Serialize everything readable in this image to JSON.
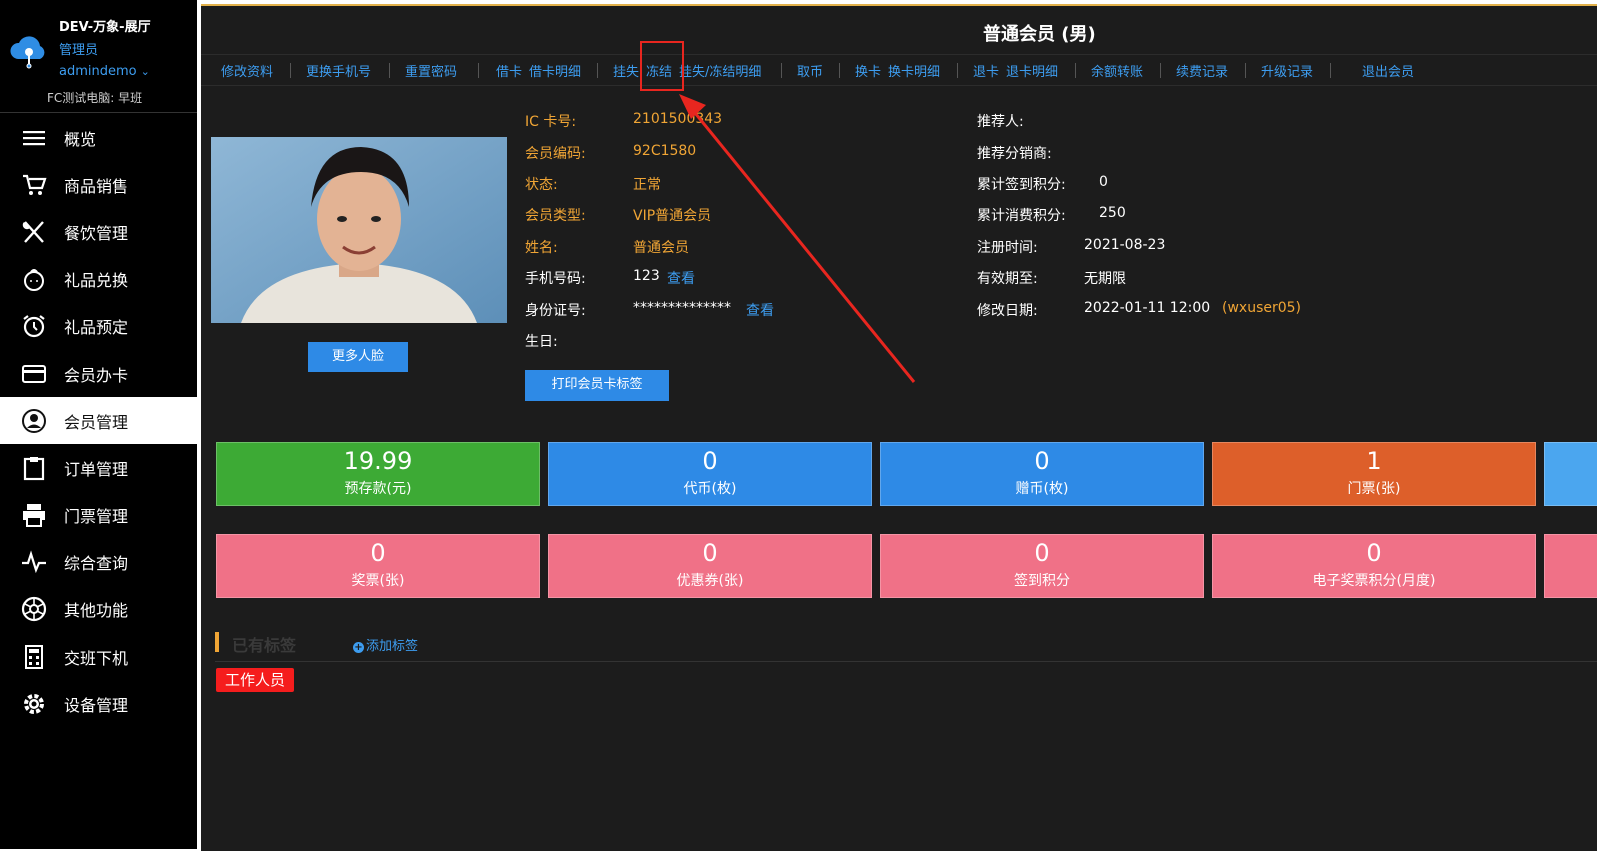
{
  "brand": {
    "title": "DEV-万象-展厅",
    "role": "管理员",
    "user": "admindemo",
    "shift": "FC测试电脑: 早班"
  },
  "menu": [
    {
      "label": "概览",
      "icon": "menu-lines-icon"
    },
    {
      "label": "商品销售",
      "icon": "cart-icon"
    },
    {
      "label": "餐饮管理",
      "icon": "fork-knife-icon"
    },
    {
      "label": "礼品兑换",
      "icon": "gift-icon"
    },
    {
      "label": "礼品预定",
      "icon": "alarm-clock-icon"
    },
    {
      "label": "会员办卡",
      "icon": "card-icon"
    },
    {
      "label": "会员管理",
      "icon": "user-circle-icon",
      "active": true
    },
    {
      "label": "订单管理",
      "icon": "clipboard-icon"
    },
    {
      "label": "门票管理",
      "icon": "printer-icon"
    },
    {
      "label": "综合查询",
      "icon": "pulse-icon"
    },
    {
      "label": "其他功能",
      "icon": "aperture-icon"
    },
    {
      "label": "交班下机",
      "icon": "calculator-icon"
    },
    {
      "label": "设备管理",
      "icon": "gear-icon"
    }
  ],
  "page": {
    "title": "普通会员 (男)"
  },
  "actions": [
    "修改资料",
    "更换手机号",
    "重置密码",
    "借卡",
    "借卡明细",
    "挂失",
    "冻结",
    "挂失/冻结明细",
    "取币",
    "换卡",
    "换卡明细",
    "退卡",
    "退卡明细",
    "余额转账",
    "续费记录",
    "升级记录",
    "退出会员"
  ],
  "member": {
    "more_faces_label": "更多人脸",
    "print_label": "打印会员卡标签",
    "ic_label": "IC 卡号:",
    "ic_value": "2101500343",
    "code_label": "会员编码:",
    "code_value": "92C1580",
    "status_label": "状态:",
    "status_value": "正常",
    "type_label": "会员类型:",
    "type_value": "VIP普通会员",
    "name_label": "姓名:",
    "name_value": "普通会员",
    "phone_label": "手机号码:",
    "phone_value": "123",
    "view_label": "查看",
    "id_label": "身份证号:",
    "id_value": "**************",
    "birthday_label": "生日:",
    "referrer_label": "推荐人:",
    "distributor_label": "推荐分销商:",
    "signin_points_label": "累计签到积分:",
    "signin_points_value": "0",
    "consume_points_label": "累计消费积分:",
    "consume_points_value": "250",
    "register_label": "注册时间:",
    "register_value": "2021-08-23",
    "valid_label": "有效期至:",
    "valid_value": "无期限",
    "modified_label": "修改日期:",
    "modified_value": "2022-01-11 12:00",
    "modified_by": "(wxuser05)"
  },
  "tiles_row1": [
    {
      "value": "19.99",
      "label": "预存款(元)",
      "color": "#3daa35"
    },
    {
      "value": "0",
      "label": "代币(枚)",
      "color": "#2e8ae6"
    },
    {
      "value": "0",
      "label": "赠币(枚)",
      "color": "#2e8ae6"
    },
    {
      "value": "1",
      "label": "门票(张)",
      "color": "#dd5f2a"
    }
  ],
  "tiles_row2": [
    {
      "value": "0",
      "label": "奖票(张)",
      "color": "#f07187"
    },
    {
      "value": "0",
      "label": "优惠券(张)",
      "color": "#f07187"
    },
    {
      "value": "0",
      "label": "签到积分",
      "color": "#f07187"
    },
    {
      "value": "0",
      "label": "电子奖票积分(月度)",
      "color": "#f07187"
    }
  ],
  "tags": {
    "title": "已有标签",
    "add_label": "添加标签",
    "items": [
      "工作人员"
    ]
  }
}
